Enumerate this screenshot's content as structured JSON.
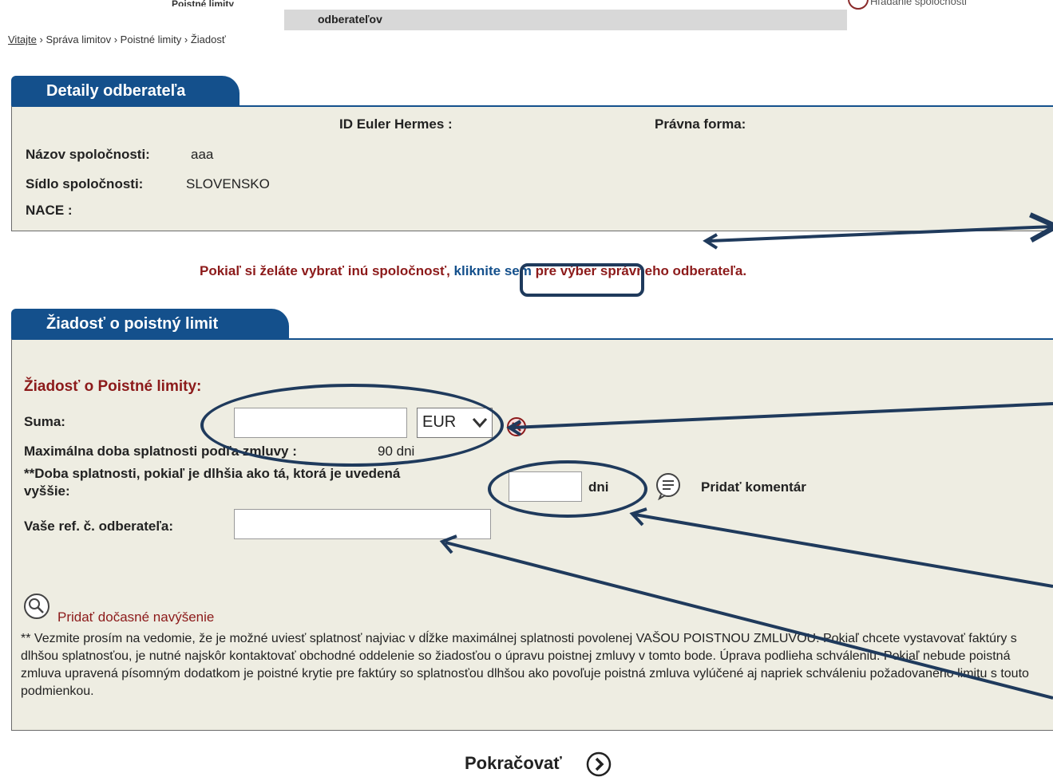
{
  "top": {
    "left_label": "Poistné limity",
    "gray_label": "odberateľov",
    "right_label": "Hľadanie spoločnosti"
  },
  "breadcrumb": {
    "home": "Vitajte",
    "sep1": " › ",
    "item2": "Správa limitov",
    "sep2": " › ",
    "item3": "Poistné limity",
    "sep3": " › ",
    "item4": "Žiadosť"
  },
  "details": {
    "tab_label": "Detaily odberateľa",
    "id_label": "ID Euler Hermes :",
    "legal_form_label": "Právna forma:",
    "company_name_label": "Názov spoločnosti:",
    "company_name_value": "aaa",
    "seat_label": "Sídlo spoločnosti:",
    "seat_value": "SLOVENSKO",
    "nace_label": "NACE :"
  },
  "select_company": {
    "before": "Pokiaľ si želáte vybrať inú spoločnosť, ",
    "link": "kliknite sem",
    "after": " pre výber správneho odberateľa."
  },
  "request": {
    "tab_label": "Žiadosť o poistný limit",
    "heading": "Žiadosť o Poistné limity:",
    "sum_label": "Suma:",
    "sum_value": "",
    "currency_selected": "EUR",
    "max_term_label": "Maximálna doba splatnosti podľa zmluvy :",
    "max_term_value": "90 dni",
    "longer_term_label_line1": "**Doba splatnosti, pokiaľ je dlhšia ako tá, ktorá je uvedená",
    "longer_term_label_line2": "vyššie:",
    "longer_term_value": "",
    "days_unit": "dni",
    "add_comment": "Pridať komentár",
    "ref_label": "Vaše ref. č. odberateľa:",
    "ref_value": "",
    "add_temp_increase": "Pridať dočasné navýšenie",
    "note": "** Vezmite prosím na vedomie, že je možné uviesť splatnosť najviac v dĺžke maximálnej splatnosti povolenej VAŠOU POISTNOU ZMLUVOU. Pokiaľ chcete vystavovať faktúry s dlhšou splatnosťou, je nutné najskôr kontaktovať obchodné oddelenie so žiadosťou o úpravu poistnej zmluvy v tomto bode. Úprava podlieha schváleniu. Pokiaľ nebude poistná zmluva upravená písomným dodatkom je poistné krytie pre faktúry so splatnosťou dlhšou ako povoľuje poistná zmluva vylúčené aj napriek schváleniu požadovaného limitu s touto podmienkou."
  },
  "continue_label": "Pokračovať",
  "colors": {
    "tab_blue": "#14508c",
    "panel_bg": "#eeede2",
    "dark_red": "#8c1a1a",
    "callout_navy": "#1f3a5c"
  }
}
